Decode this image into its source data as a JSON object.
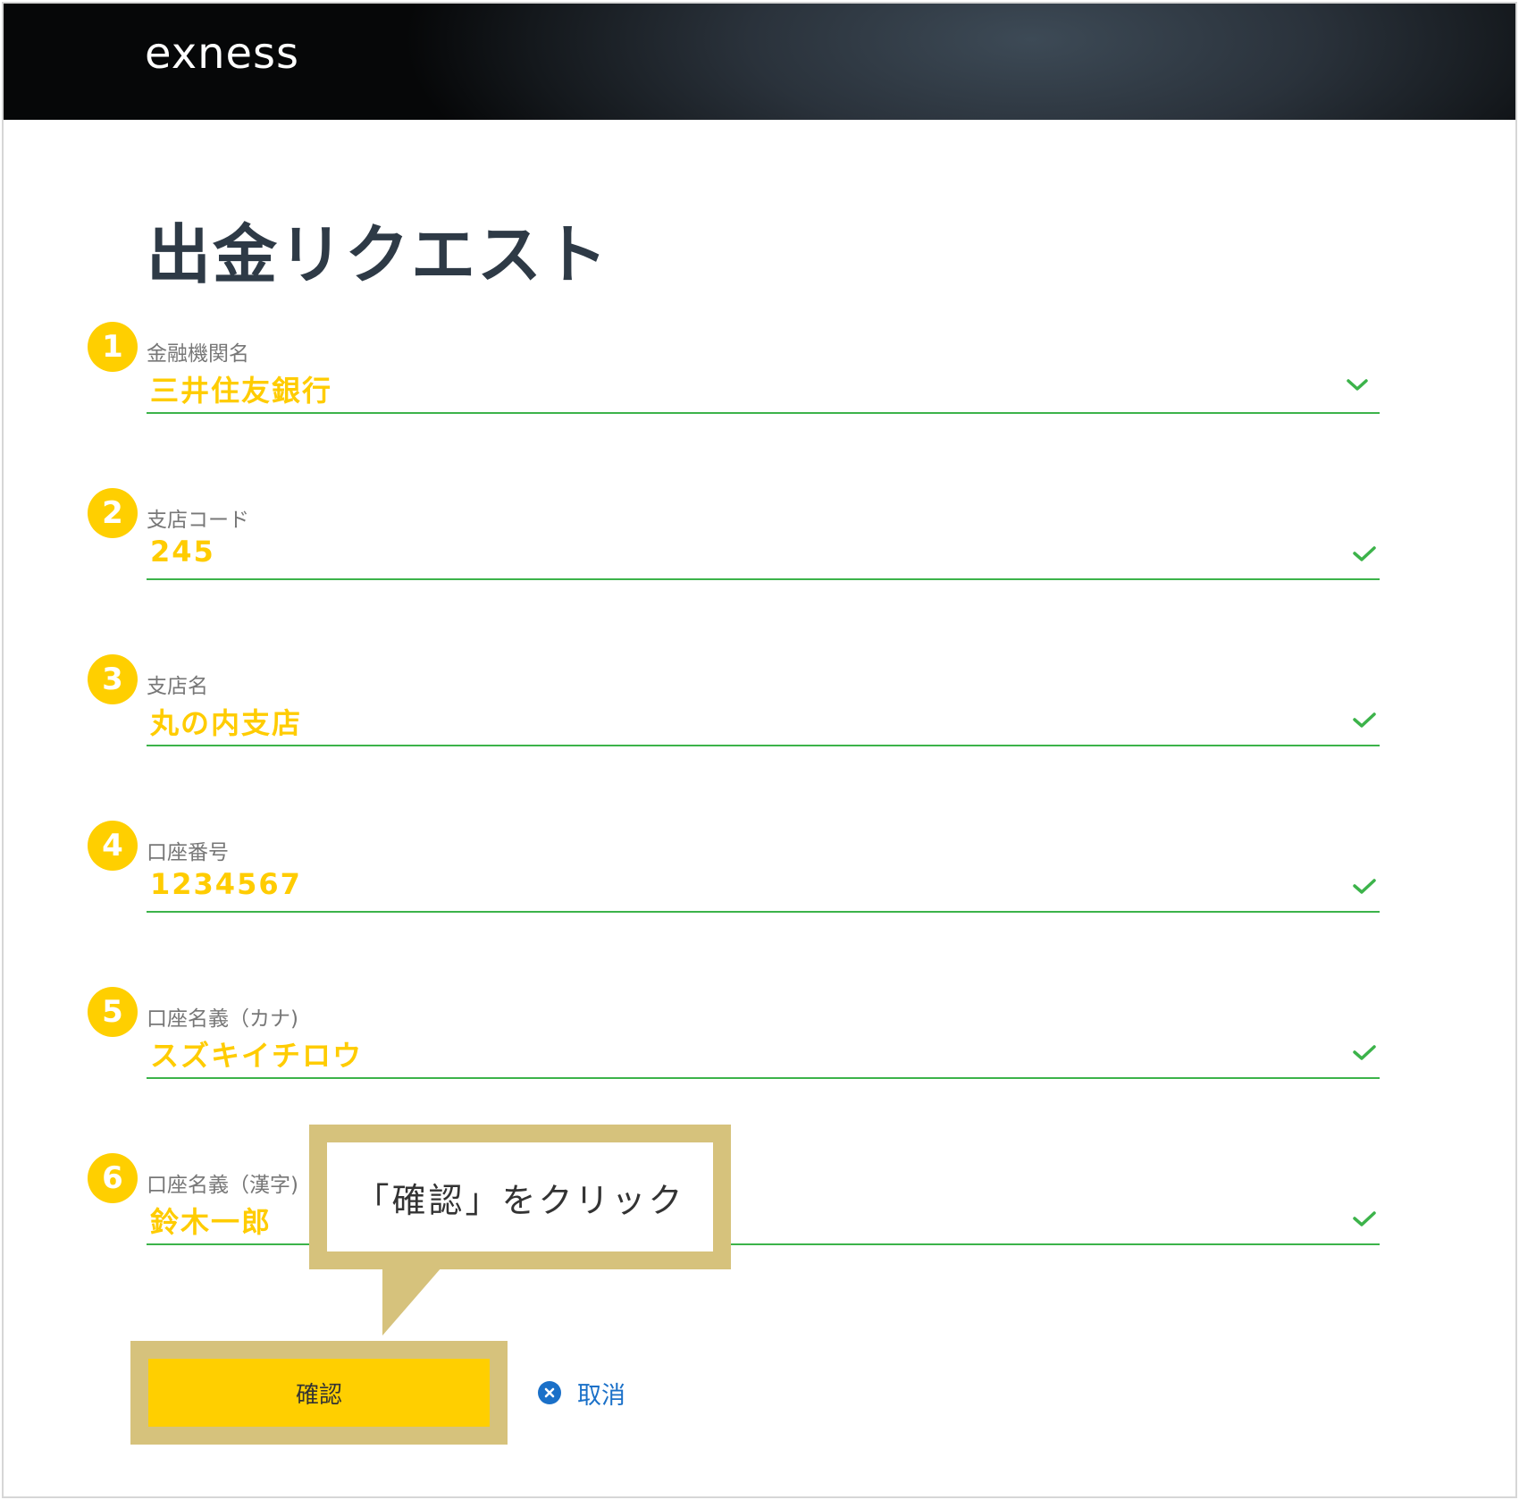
{
  "header": {
    "logo": "exness"
  },
  "page": {
    "title": "出金リクエスト"
  },
  "fields": [
    {
      "number": "1",
      "label": "金融機関名",
      "value": "三井住友銀行",
      "indicator": "chevron-down-icon"
    },
    {
      "number": "2",
      "label": "支店コード",
      "value": "245",
      "indicator": "check-icon"
    },
    {
      "number": "3",
      "label": "支店名",
      "value": "丸の内支店",
      "indicator": "check-icon"
    },
    {
      "number": "4",
      "label": "口座番号",
      "value": "1234567",
      "indicator": "check-icon"
    },
    {
      "number": "5",
      "label": "口座名義（カナ)",
      "value": "スズキイチロウ",
      "indicator": "check-icon"
    },
    {
      "number": "6",
      "label": "口座名義（漢字)",
      "value": "鈴木一郎",
      "indicator": "check-icon"
    }
  ],
  "callout": {
    "text": "「確認」をクリック"
  },
  "actions": {
    "confirm_label": "確認",
    "cancel_label": "取消"
  },
  "colors": {
    "accent": "#ffcf00",
    "valid": "#3cb34a",
    "link": "#1a70c8",
    "highlight": "#d6c27c"
  }
}
